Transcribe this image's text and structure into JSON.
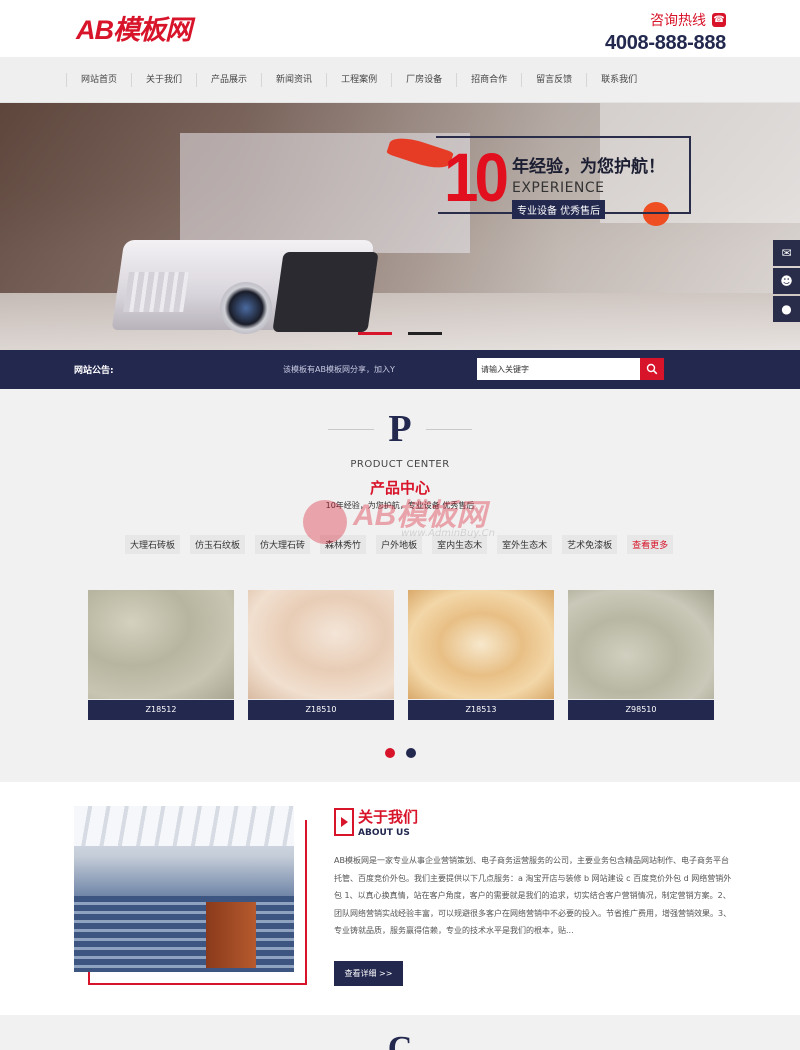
{
  "header": {
    "logo": "AB模板网",
    "hotline_label": "咨询热线",
    "hotline_number": "4008-888-888"
  },
  "nav": {
    "items": [
      "网站首页",
      "关于我们",
      "产品展示",
      "新闻资讯",
      "工程案例",
      "厂房设备",
      "招商合作",
      "留言反馈",
      "联系我们"
    ]
  },
  "banner": {
    "big_number": "10",
    "headline": "年经验，为您护航！",
    "english": "EXPERIENCE",
    "tagline": "专业设备 优秀售后",
    "dots_count": 2,
    "active_dot": 0
  },
  "side_tools": {
    "icons": [
      "wechat-icon",
      "users-icon",
      "qq-icon"
    ]
  },
  "notice": {
    "label": "网站公告:",
    "text": "该模板有AB模板网分享，加入Y",
    "search_value": "请输入关键字"
  },
  "products": {
    "big_letter": "P",
    "title_en": "PRODUCT CENTER",
    "title_cn": "产品中心",
    "subtitle": "10年经验，为您护航，专业设备 优秀售后",
    "categories": [
      "大理石砖板",
      "仿玉石纹板",
      "仿大理石砖",
      "森林秀竹",
      "户外地板",
      "室内生态木",
      "室外生态木",
      "艺术免漆板"
    ],
    "more_label": "查看更多",
    "items": [
      {
        "caption": "Z18512"
      },
      {
        "caption": "Z18510"
      },
      {
        "caption": "Z18513"
      },
      {
        "caption": "Z98510"
      }
    ],
    "watermark": {
      "text": "AB模板网",
      "url": "www.AdminBuy.Cn"
    }
  },
  "about": {
    "title": "关于我们",
    "title_en": "ABOUT US",
    "body": "AB模板网是一家专业从事企业营销策划、电子商务运营服务的公司，主要业务包含精品网站制作、电子商务平台托管、百度竞价外包。我们主要提供以下几点服务：a 淘宝开店与装修 b 网站建设 c 百度竞价外包 d 网络营销外包 1、以真心换真情，站在客户角度，客户的需要就是我们的追求，切实结合客户营销情况，制定营销方案。2、团队网络营销实战经验丰富，可以规避很多客户在网络营销中不必要的投入。节省推广费用，增强营销效果。3、专业铸就品质，服务赢得信赖，专业的技术水平是我们的根本，贴...",
    "button": "查看详细 >>"
  },
  "next_section": {
    "big_letter": "C"
  }
}
